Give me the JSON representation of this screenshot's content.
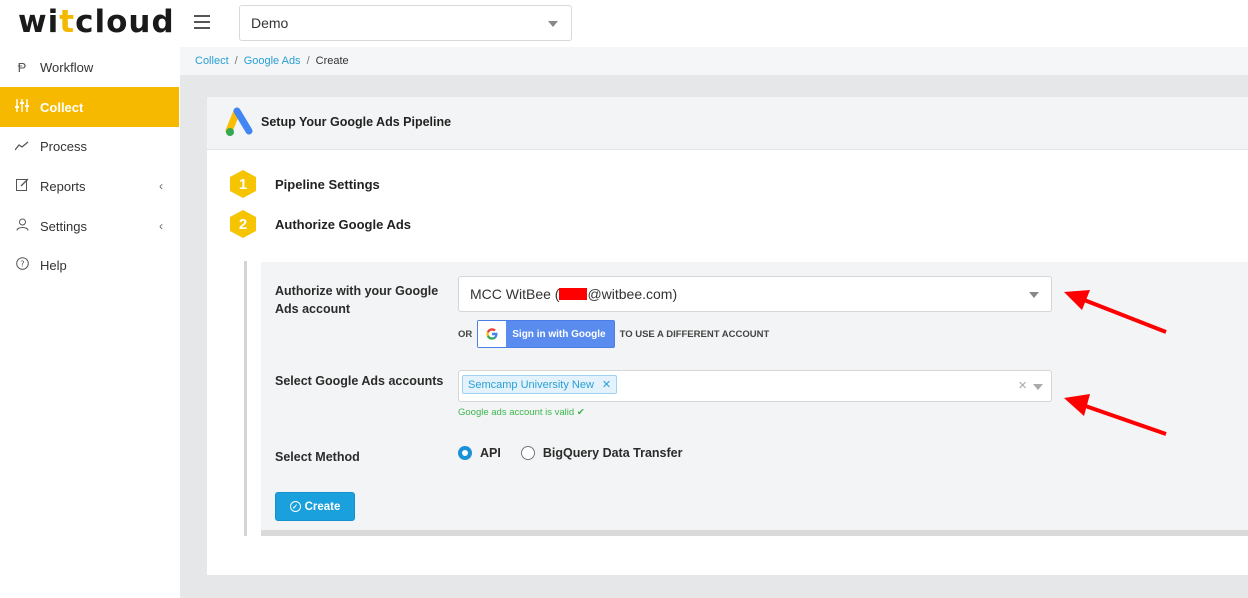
{
  "header": {
    "logo_prefix": "wi",
    "logo_accent": "t",
    "logo_suffix": "cloud",
    "project_selected": "Demo"
  },
  "sidebar": {
    "items": [
      {
        "label": "Workflow",
        "icon": "workflow-icon"
      },
      {
        "label": "Collect",
        "icon": "sliders-icon",
        "active": true
      },
      {
        "label": "Process",
        "icon": "chart-line-icon"
      },
      {
        "label": "Reports",
        "icon": "edit-icon",
        "expandable": true
      },
      {
        "label": "Settings",
        "icon": "user-icon",
        "expandable": true
      },
      {
        "label": "Help",
        "icon": "question-icon"
      }
    ]
  },
  "breadcrumb": {
    "items": [
      "Collect",
      "Google Ads",
      "Create"
    ],
    "separator": "/"
  },
  "card": {
    "title": "Setup Your Google Ads Pipeline"
  },
  "steps": [
    {
      "number": "1",
      "label": "Pipeline Settings"
    },
    {
      "number": "2",
      "label": "Authorize Google Ads"
    }
  ],
  "form": {
    "authorize_label": "Authorize with your Google Ads account",
    "account_prefix": "MCC WitBee (",
    "account_suffix": "@witbee.com)",
    "or_text": "OR",
    "google_button_label": "Sign in with Google",
    "different_account_text": "TO USE A DIFFERENT ACCOUNT",
    "select_accounts_label": "Select Google Ads accounts",
    "selected_account_tag": "Semcamp University New",
    "valid_message": "Google ads account is valid",
    "method_label": "Select Method",
    "methods": [
      {
        "label": "API",
        "selected": true
      },
      {
        "label": "BigQuery Data Transfer",
        "selected": false
      }
    ],
    "create_button": "Create"
  },
  "colors": {
    "accent": "#f6b900",
    "link": "#2a9fd6",
    "primary_button": "#1aa0dc",
    "annotation_arrow": "#ff0000",
    "valid": "#3cb64c"
  }
}
